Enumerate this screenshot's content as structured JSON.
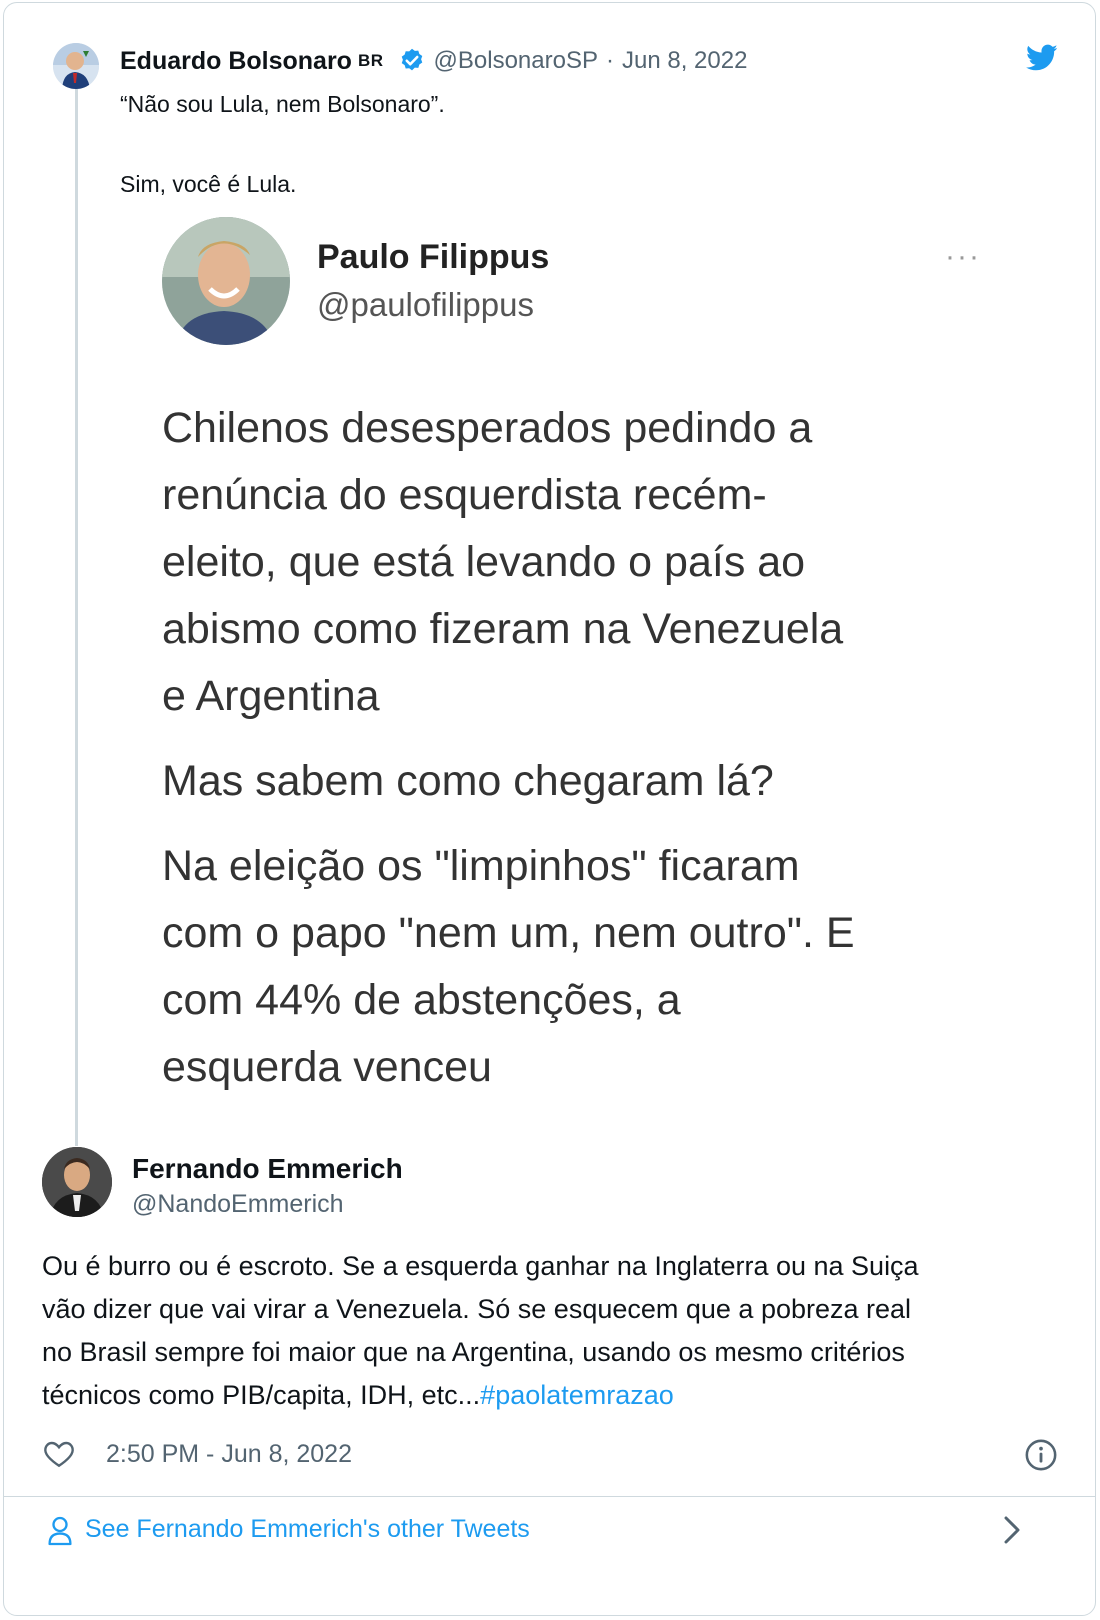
{
  "quoted_tweet": {
    "author_name": "Eduardo Bolsonaro",
    "author_flag": "BR",
    "author_handle": "@BolsonaroSP",
    "separator": "·",
    "date": "Jun 8, 2022",
    "text_lines": [
      "“Não sou Lula, nem Bolsonaro”.",
      "",
      "Sim, você é Lula."
    ],
    "brand_color": "#1d9bf0",
    "icons": {
      "verified": "verified-badge-icon",
      "brand": "twitter-bird-icon"
    }
  },
  "embedded_screenshot": {
    "author_name": "Paulo Filippus",
    "author_handle": "@paulofilippus",
    "more_glyph": "···",
    "paragraph_1": [
      "Chilenos desesperados pedindo a",
      "renúncia do esquerdista recém-",
      "eleito, que está levando o país ao",
      "abismo como fizeram na Venezuela",
      "e Argentina"
    ],
    "paragraph_2": [
      "Mas sabem como chegaram lá?"
    ],
    "paragraph_3": [
      "Na eleição os \"limpinhos\" ficaram",
      "com o papo \"nem um, nem outro\". E",
      "com 44% de abstenções, a",
      "esquerda venceu"
    ]
  },
  "reply_tweet": {
    "author_name": "Fernando Emmerich",
    "author_handle": "@NandoEmmerich",
    "text_lines": [
      "Ou é burro ou é escroto. Se a esquerda ganhar na Inglaterra ou na Suiça",
      "vão dizer que vai virar a Venezuela. Só se esquecem que a pobreza real",
      "no Brasil sempre foi maior que na Argentina, usando os mesmo critérios"
    ],
    "last_line_text": "técnicos como PIB/capita, IDH, etc...",
    "hashtag": "#paolatemrazao",
    "timestamp": "2:50 PM - Jun 8, 2022",
    "icons": {
      "like": "heart-icon",
      "info": "info-icon"
    }
  },
  "footer": {
    "label": "See Fernando Emmerich's other Tweets",
    "icons": {
      "person": "person-icon",
      "chevron": "chevron-right-icon"
    }
  }
}
